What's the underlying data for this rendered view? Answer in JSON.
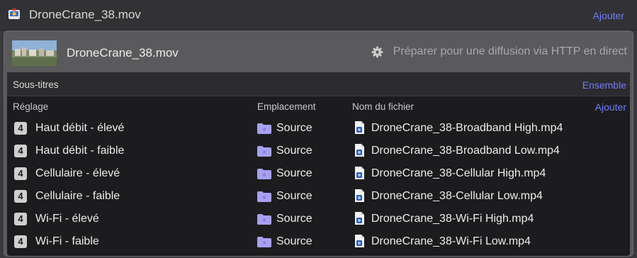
{
  "window": {
    "title": "DroneCrane_38.mov",
    "add_label": "Ajouter"
  },
  "clip": {
    "name": "DroneCrane_38.mov",
    "prepare_label": "Préparer pour une diffusion via HTTP en direct"
  },
  "subtitles": {
    "label": "Sous-titres",
    "set_label": "Ensemble"
  },
  "table": {
    "headers": {
      "setting": "Réglage",
      "location": "Emplacement",
      "filename": "Nom du fichier",
      "add": "Ajouter"
    },
    "rows": [
      {
        "badge": "4",
        "setting": "Haut débit - élevé",
        "location": "Source",
        "filename": "DroneCrane_38-Broadband High.mp4"
      },
      {
        "badge": "4",
        "setting": "Haut débit - faible",
        "location": "Source",
        "filename": "DroneCrane_38-Broadband Low.mp4"
      },
      {
        "badge": "4",
        "setting": "Cellulaire - élevé",
        "location": "Source",
        "filename": "DroneCrane_38-Cellular High.mp4"
      },
      {
        "badge": "4",
        "setting": "Cellulaire - faible",
        "location": "Source",
        "filename": "DroneCrane_38-Cellular Low.mp4"
      },
      {
        "badge": "4",
        "setting": "Wi-Fi - élevé",
        "location": "Source",
        "filename": "DroneCrane_38-Wi-Fi High.mp4"
      },
      {
        "badge": "4",
        "setting": "Wi-Fi - faible",
        "location": "Source",
        "filename": "DroneCrane_38-Wi-Fi Low.mp4"
      }
    ]
  },
  "icons": {
    "app": "compressor-app-icon",
    "gear": "gear-icon",
    "folder": "folder-icon",
    "file": "video-file-icon"
  },
  "colors": {
    "accent_link": "#6e7cff",
    "folder": "#a8a0f0",
    "window_bg": "#3a3a3c",
    "table_bg": "#1c1c1e"
  }
}
